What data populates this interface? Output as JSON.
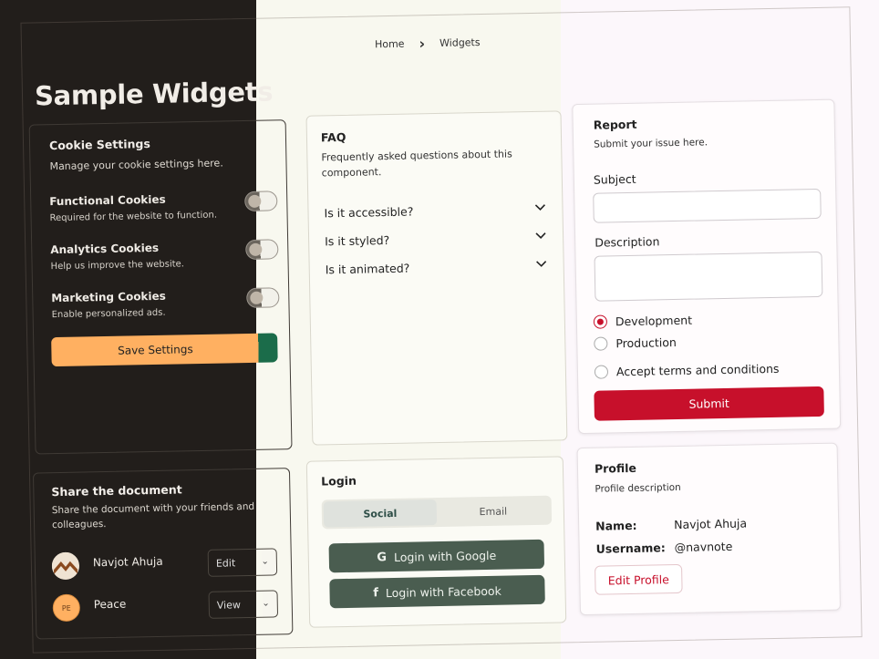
{
  "breadcrumb": {
    "home": "Home",
    "separator": "›",
    "current": "Widgets"
  },
  "page_title": "Sample Widgets",
  "cookie": {
    "title": "Cookie Settings",
    "subtitle": "Manage your cookie settings here.",
    "items": [
      {
        "label": "Functional Cookies",
        "desc": "Required for the website to function."
      },
      {
        "label": "Analytics Cookies",
        "desc": "Help us improve the website."
      },
      {
        "label": "Marketing Cookies",
        "desc": "Enable personalized ads."
      }
    ],
    "save_label": "Save Settings"
  },
  "share": {
    "title": "Share the document",
    "subtitle": "Share the document with your friends and colleagues.",
    "people": [
      {
        "name": "Navjot Ahuja",
        "initials": "",
        "permission": "Edit"
      },
      {
        "name": "Peace",
        "initials": "PE",
        "permission": "View"
      }
    ]
  },
  "faq": {
    "title": "FAQ",
    "subtitle": "Frequently asked questions about this component.",
    "items": [
      "Is it accessible?",
      "Is it styled?",
      "Is it animated?"
    ]
  },
  "login": {
    "title": "Login",
    "tabs": [
      "Social",
      "Email"
    ],
    "google_label": "Login with Google",
    "facebook_label": "Login with Facebook"
  },
  "report": {
    "title": "Report",
    "subtitle": "Submit your issue here.",
    "subject_label": "Subject",
    "description_label": "Description",
    "radios": [
      "Development",
      "Production"
    ],
    "terms_label": "Accept terms and conditions",
    "submit_label": "Submit"
  },
  "profile": {
    "title": "Profile",
    "subtitle": "Profile description",
    "name_label": "Name:",
    "name_value": "Navjot Ahuja",
    "username_label": "Username:",
    "username_value": "@navnote",
    "edit_label": "Edit Profile"
  },
  "colors": {
    "accent_orange": "#ffb061",
    "accent_red": "#c7102b",
    "accent_green": "#4a5d50"
  }
}
